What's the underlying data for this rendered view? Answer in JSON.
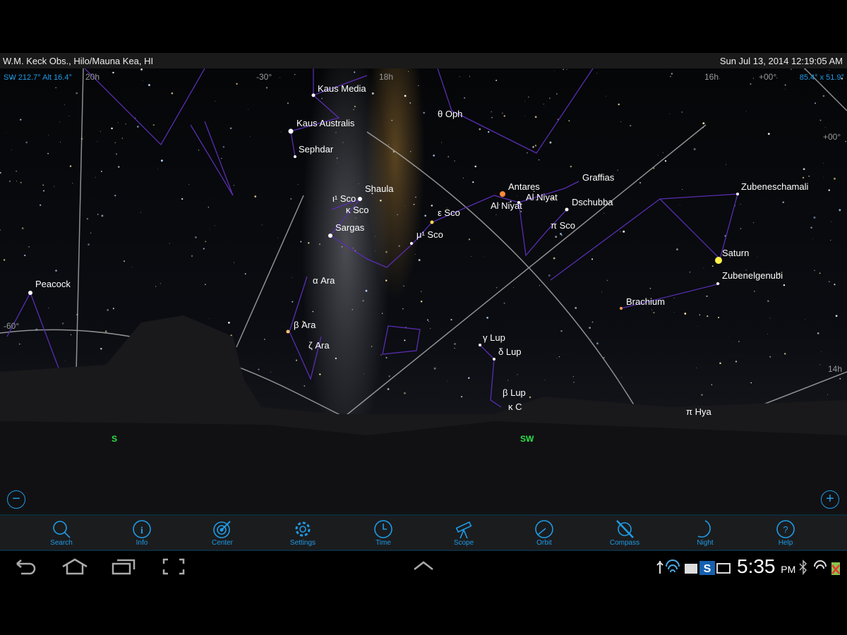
{
  "header": {
    "location": "W.M. Keck Obs., Hilo/Mauna Kea, HI",
    "datetime": "Sun Jul 13, 2014  12:19:05 AM"
  },
  "hud": {
    "pointing": "SW 212.7° Alt 16.4°",
    "field_of_view": "85.4° x 51.9°"
  },
  "grid_labels": [
    "20h",
    "-30°",
    "18h",
    "16h",
    "+00°",
    "+00°",
    "-60°",
    "14h"
  ],
  "objects": [
    "Kaus Media",
    "Kaus Australis",
    "Sephdar",
    "θ Oph",
    "Shaula",
    "ι¹ Sco",
    "κ Sco",
    "Sargas",
    "ε Sco",
    "μ¹ Sco",
    "Antares",
    "Al Niyat",
    "Al Niyat",
    "Graffias",
    "Dschubba",
    "π Sco",
    "Zubeneschamali",
    "Saturn",
    "Zubenelgenubi",
    "Brachium",
    "Peacock",
    "α Ara",
    "β Ara",
    "ζ Ara",
    "γ Lup",
    "δ Lup",
    "β Lup",
    "κ C",
    "π Hya"
  ],
  "compass": [
    "S",
    "SW"
  ],
  "zoom": {
    "out": "−",
    "in": "+"
  },
  "toolbar": [
    {
      "label": "Search",
      "icon": "search-icon"
    },
    {
      "label": "Info",
      "icon": "info-icon"
    },
    {
      "label": "Center",
      "icon": "target-icon"
    },
    {
      "label": "Settings",
      "icon": "gear-icon"
    },
    {
      "label": "Time",
      "icon": "clock-icon"
    },
    {
      "label": "Scope",
      "icon": "telescope-icon"
    },
    {
      "label": "Orbit",
      "icon": "orbit-icon"
    },
    {
      "label": "Compass",
      "icon": "compass-icon"
    },
    {
      "label": "Night",
      "icon": "moon-icon"
    },
    {
      "label": "Help",
      "icon": "help-icon"
    }
  ],
  "status": {
    "time": "5:35",
    "ampm": "PM"
  },
  "colors": {
    "accent": "#1e9be6",
    "constellation": "#5a2db0",
    "compass": "#2ee04a"
  }
}
